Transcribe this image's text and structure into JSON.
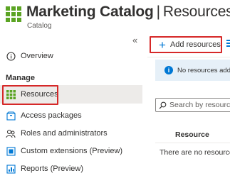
{
  "header": {
    "title": "Marketing Catalog",
    "separator": "|",
    "title_suffix": "Resources",
    "subtitle": "Catalog",
    "icon": "catalog-grid-icon",
    "icon_color": "#5ba423"
  },
  "sidebar": {
    "collapse_glyph": "«",
    "overview_label": "Overview",
    "section_label": "Manage",
    "items": [
      {
        "label": "Resources",
        "icon": "grid-icon",
        "selected": true
      },
      {
        "label": "Access packages",
        "icon": "package-icon"
      },
      {
        "label": "Roles and administrators",
        "icon": "people-icon"
      },
      {
        "label": "Custom extensions (Preview)",
        "icon": "extension-icon"
      },
      {
        "label": "Reports (Preview)",
        "icon": "report-icon"
      }
    ]
  },
  "toolbar": {
    "add_label": "Add resources",
    "add_glyph": "+"
  },
  "banner": {
    "text": "No resources added"
  },
  "search": {
    "placeholder": "Search by resource"
  },
  "table": {
    "column_header": "Resource",
    "empty_text": "There are no resources"
  },
  "colors": {
    "accent": "#0078d4",
    "highlight": "#d62828",
    "selected_bg": "#edebe9"
  }
}
